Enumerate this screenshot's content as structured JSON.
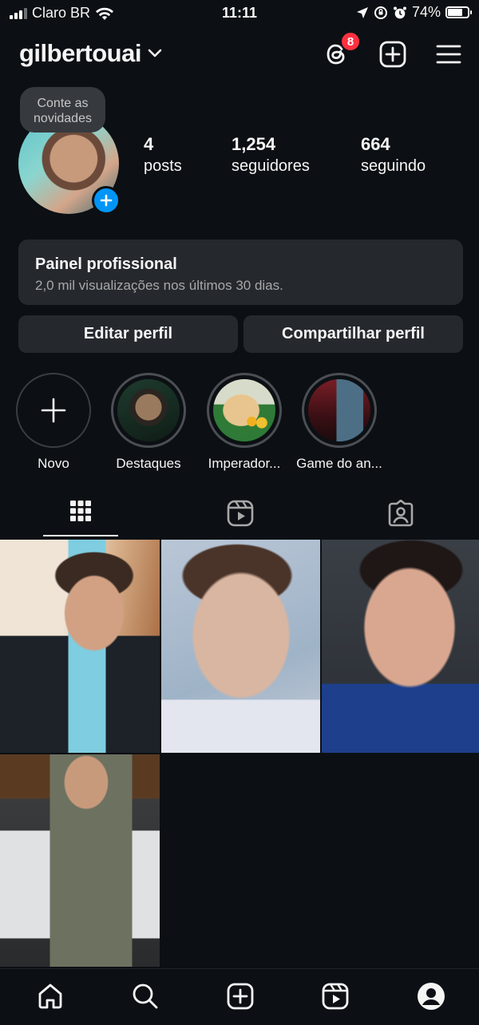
{
  "status_bar": {
    "carrier": "Claro BR",
    "time": "11:11",
    "battery": "74%",
    "battery_level": 0.74
  },
  "header": {
    "username": "gilbertouai",
    "notification_count": "8"
  },
  "profile": {
    "note": "Conte as novidades",
    "stats": [
      {
        "value": "4",
        "label": "posts"
      },
      {
        "value": "1,254",
        "label": "seguidores"
      },
      {
        "value": "664",
        "label": "seguindo"
      }
    ]
  },
  "panel": {
    "title": "Painel profissional",
    "subtitle": "2,0 mil visualizações nos últimos 30 dias."
  },
  "buttons": {
    "edit": "Editar perfil",
    "share": "Compartilhar perfil"
  },
  "highlights": [
    {
      "label": "Novo"
    },
    {
      "label": "Destaques"
    },
    {
      "label": "Imperador..."
    },
    {
      "label": "Game do an..."
    }
  ],
  "colors": {
    "background": "#0c1014",
    "surface": "#25292e",
    "accent": "#0095f6",
    "badge": "#ff3040"
  },
  "icons": {
    "header": [
      "threads-icon",
      "create-post-icon",
      "menu-icon"
    ],
    "tabs": [
      "grid-icon",
      "reels-icon",
      "tagged-icon"
    ],
    "nav": [
      "home-icon",
      "search-icon",
      "create-icon",
      "reels-icon",
      "profile-icon"
    ]
  }
}
